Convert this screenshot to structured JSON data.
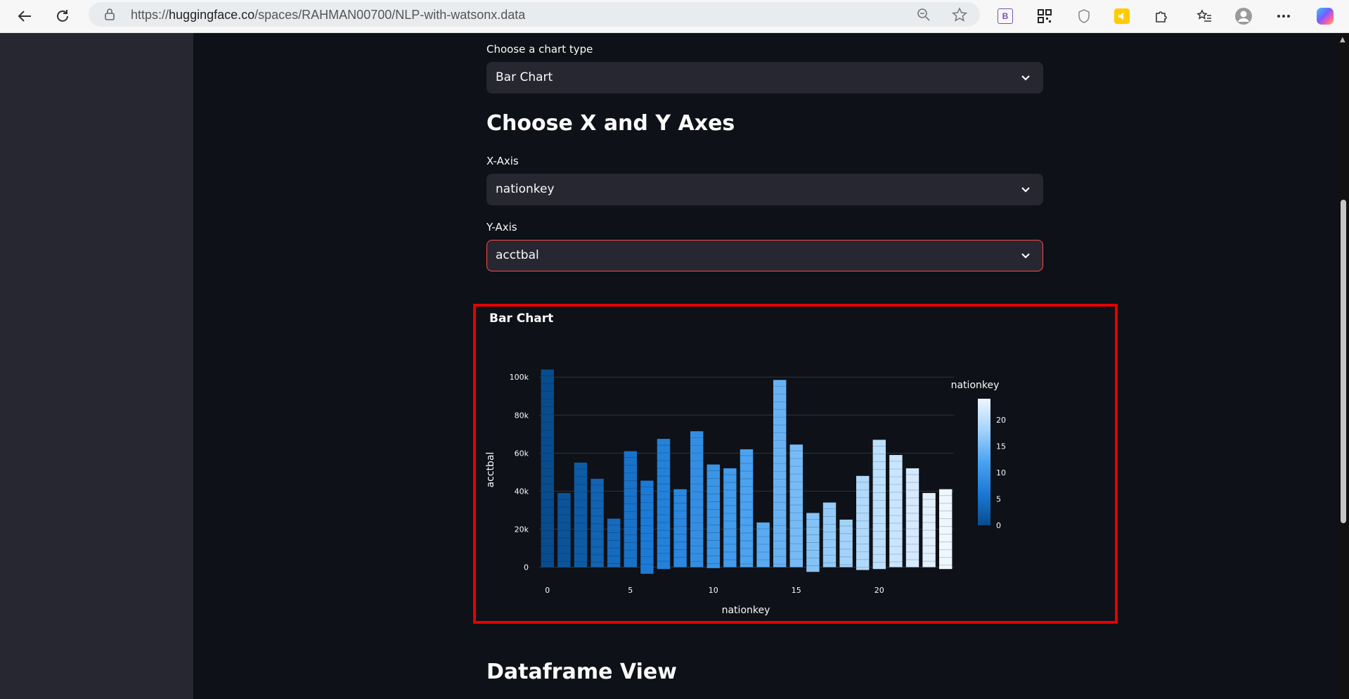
{
  "browser": {
    "url_prefix": "https://",
    "url_host": "huggingface.co",
    "url_path": "/spaces/RAHMAN00700/NLP-with-watsonx.data"
  },
  "controls": {
    "chart_type_label": "Choose a chart type",
    "chart_type_value": "Bar Chart",
    "axes_heading": "Choose X and Y Axes",
    "x_axis_label": "X-Axis",
    "x_axis_value": "nationkey",
    "y_axis_label": "Y-Axis",
    "y_axis_value": "acctbal"
  },
  "chart_card": {
    "title": "Bar Chart"
  },
  "dataframe_heading": "Dataframe View",
  "chart_data": {
    "type": "bar",
    "title": "Bar Chart",
    "xlabel": "nationkey",
    "ylabel": "acctbal",
    "x": [
      0,
      1,
      2,
      3,
      4,
      5,
      6,
      7,
      8,
      9,
      10,
      11,
      12,
      13,
      14,
      15,
      16,
      17,
      18,
      19,
      20,
      21,
      22,
      23,
      24
    ],
    "values": [
      104000,
      39000,
      55000,
      46500,
      25500,
      61000,
      45500,
      67500,
      41000,
      71500,
      54000,
      52000,
      62000,
      23500,
      98500,
      64500,
      28500,
      34000,
      25000,
      48000,
      67000,
      59000,
      52000,
      39000,
      41000
    ],
    "min_values": [
      0,
      0,
      0,
      0,
      0,
      0,
      -3500,
      -1000,
      0,
      0,
      -500,
      0,
      0,
      0,
      0,
      0,
      -2500,
      0,
      0,
      -1500,
      -1000,
      0,
      0,
      0,
      -1000
    ],
    "x_ticks": [
      "0",
      "5",
      "10",
      "15",
      "20"
    ],
    "y_ticks": [
      "0",
      "20k",
      "40k",
      "60k",
      "80k",
      "100k"
    ],
    "ylim": [
      -5000,
      106000
    ],
    "colorbar": {
      "title": "nationkey",
      "ticks": [
        "0",
        "5",
        "10",
        "15",
        "20"
      ],
      "range": [
        0,
        24
      ]
    },
    "colors": {
      "low": "#084c8d",
      "high": "#eef6ff"
    },
    "grid": true
  }
}
